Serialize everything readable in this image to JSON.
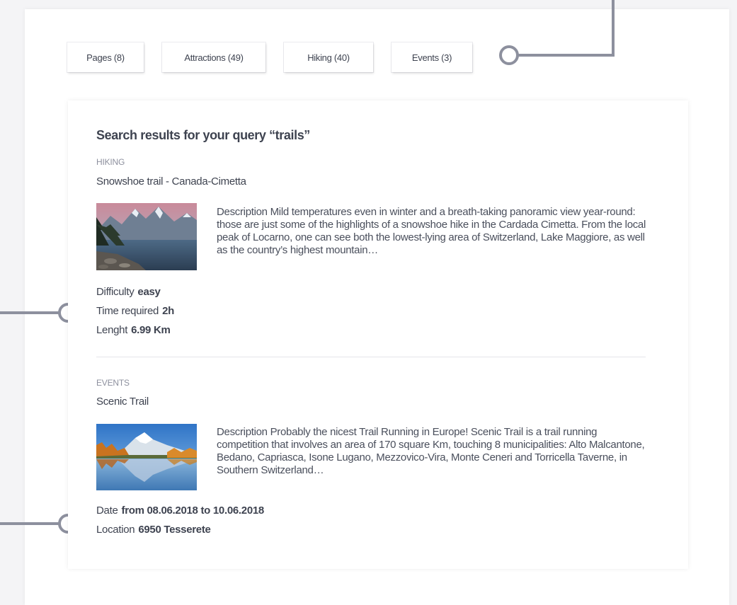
{
  "tabs": [
    {
      "label": "Pages (8)"
    },
    {
      "label": "Attractions (49)"
    },
    {
      "label": "Hiking (40)"
    },
    {
      "label": "Events (3)"
    }
  ],
  "results": {
    "heading": "Search results for your query “trails”",
    "hiking": {
      "category": "HIKING",
      "title": "Snowshoe trail - Canada-Cimetta",
      "description": "Description Mild temperatures even in winter and a breath-taking panoramic view year-round: those are just some of the highlights of a snowshoe hike in the Cardada Cimetta. From the local peak of Locarno, one can see both the lowest-lying area of Switzerland, Lake Maggiore, as well as the country’s highest mountain…",
      "difficulty_label": "Difficulty",
      "difficulty_value": "easy",
      "time_label": "Time required",
      "time_value": "2h",
      "length_label": "Lenght",
      "length_value": "6.99 Km"
    },
    "event": {
      "category": "EVENTS",
      "title": "Scenic Trail",
      "description": "Description Probably the nicest Trail Running in Europe! Scenic Trail is a trail running competition that involves an area of 170 square Km, touching 8 municipalities: Alto Malcantone, Bedano, Capriasca, Isone Lugano, Mezzovico-Vira, Monte Ceneri and Torricella Taverne, in Southern Switzerland…",
      "date_label": "Date",
      "date_value": "from 08.06.2018 to 10.06.2018",
      "location_label": "Location",
      "location_value": "6950 Tesserete"
    }
  },
  "colors": {
    "annotation": "#8d909e",
    "text": "#3e4350",
    "muted": "#8d909e"
  }
}
